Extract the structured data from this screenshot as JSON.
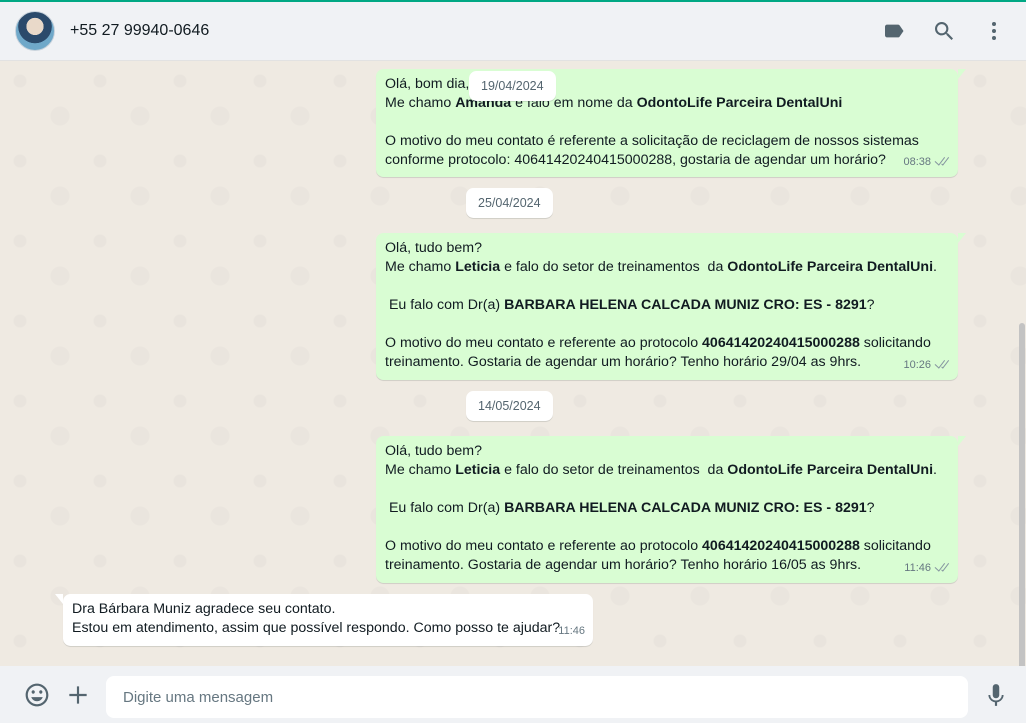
{
  "header": {
    "contact_name": "+55 27 99940-0646"
  },
  "icons": {
    "label": "label-icon",
    "search": "search-icon",
    "menu": "kebab-menu-icon",
    "emoji": "emoji-icon",
    "attach": "plus-icon",
    "mic": "microphone-icon"
  },
  "dates": {
    "d1": "19/04/2024",
    "d2": "25/04/2024",
    "d3": "14/05/2024"
  },
  "messages": [
    {
      "direction": "out",
      "time": "08:38",
      "lines": {
        "l1": "Olá, bom dia,",
        "l2a": "Me chamo ",
        "l2b": "Amanda",
        "l2c": " e falo em nome da ",
        "l2d": "OdontoLife Parceira DentalUni",
        "l4": "O motivo do meu contato é referente a solicitação de reciclagem de nossos sistemas",
        "l5": "conforme protocolo: 40641420240415000288, gostaria de agendar um horário?"
      }
    },
    {
      "direction": "out",
      "time": "10:26",
      "lines": {
        "l1": "Olá, tudo bem?",
        "l2a": "Me chamo ",
        "l2b": "Leticia",
        "l2c": " e falo do setor de treinamentos  da ",
        "l2d": "OdontoLife Parceira DentalUni",
        "l2e": ".",
        "l4a": " Eu falo com Dr(a) ",
        "l4b": "BARBARA HELENA CALCADA MUNIZ CRO: ES - 8291",
        "l4c": "?",
        "l6a": "O motivo do meu contato e referente ao protocolo ",
        "l6b": "40641420240415000288",
        "l6c": " solicitando",
        "l7": "treinamento. Gostaria de agendar um horário? Tenho horário 29/04 as 9hrs."
      }
    },
    {
      "direction": "out",
      "time": "11:46",
      "lines": {
        "l1": "Olá, tudo bem?",
        "l2a": "Me chamo ",
        "l2b": "Leticia",
        "l2c": " e falo do setor de treinamentos  da ",
        "l2d": "OdontoLife Parceira DentalUni",
        "l2e": ".",
        "l4a": " Eu falo com Dr(a) ",
        "l4b": "BARBARA HELENA CALCADA MUNIZ CRO: ES - 8291",
        "l4c": "?",
        "l6a": "O motivo do meu contato e referente ao protocolo ",
        "l6b": "40641420240415000288",
        "l6c": " solicitando",
        "l7": "treinamento. Gostaria de agendar um horário? Tenho horário 16/05 as 9hrs."
      }
    },
    {
      "direction": "in",
      "time": "11:46",
      "lines": {
        "l1": "Dra Bárbara Muniz agradece seu contato.",
        "l2": "Estou em atendimento, assim que possível respondo. Como posso te ajudar?"
      }
    }
  ],
  "composer": {
    "placeholder": "Digite uma mensagem"
  },
  "colors": {
    "outgoing_bubble": "#d9fdd3",
    "incoming_bubble": "#ffffff",
    "chat_background": "#efeae2",
    "header_background": "#f0f2f5",
    "accent": "#00a884"
  }
}
